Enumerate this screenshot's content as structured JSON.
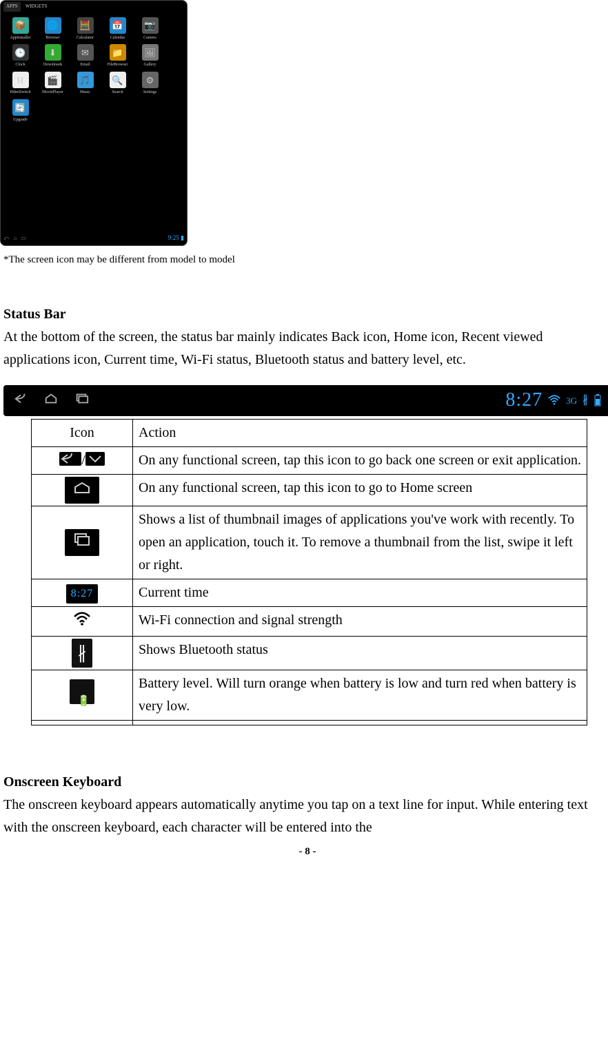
{
  "tablet": {
    "tabs": [
      "APPS",
      "WIDGETS"
    ],
    "apps": [
      {
        "label": "AppInstaller",
        "color": "#3a9",
        "glyph": "📦"
      },
      {
        "label": "Browser",
        "color": "#28c",
        "glyph": "🌐"
      },
      {
        "label": "Calculator",
        "color": "#444",
        "glyph": "🧮"
      },
      {
        "label": "Calendar",
        "color": "#28c",
        "glyph": "📅"
      },
      {
        "label": "Camera",
        "color": "#555",
        "glyph": "📷"
      },
      {
        "label": "Clock",
        "color": "#333",
        "glyph": "🕒"
      },
      {
        "label": "Downloads",
        "color": "#3a3",
        "glyph": "⬇"
      },
      {
        "label": "Email",
        "color": "#555",
        "glyph": "✉"
      },
      {
        "label": "FileBrowser",
        "color": "#c80",
        "glyph": "📁"
      },
      {
        "label": "Gallery",
        "color": "#777",
        "glyph": "🖼"
      },
      {
        "label": "HdmiSwitch",
        "color": "#eee",
        "glyph": "H"
      },
      {
        "label": "MoviePlayer",
        "color": "#eee",
        "glyph": "🎬"
      },
      {
        "label": "Music",
        "color": "#39d",
        "glyph": "🎵"
      },
      {
        "label": "Search",
        "color": "#eee",
        "glyph": "🔍"
      },
      {
        "label": "Settings",
        "color": "#666",
        "glyph": "⚙"
      },
      {
        "label": "Upgrade",
        "color": "#28c",
        "glyph": "🔄"
      }
    ],
    "nav_time": "9:25",
    "nav_sig": "▮"
  },
  "caption": "*The screen icon may be different from model to model",
  "status_section": {
    "heading": "Status Bar",
    "body": "At the bottom of the screen, the status bar mainly indicates Back icon, Home icon, Recent viewed applications icon, Current time, Wi-Fi status, Bluetooth status and battery level, etc."
  },
  "status_bar_demo": {
    "time": "8:27",
    "sig": "3G"
  },
  "table": {
    "head": [
      "Icon",
      "Action"
    ],
    "rows": [
      {
        "icon": "back",
        "action": "On any functional screen, tap this icon to go back one screen or exit application."
      },
      {
        "icon": "home",
        "action": "On any functional screen, tap this icon to go to Home screen"
      },
      {
        "icon": "recent",
        "action": "Shows a list of thumbnail images of applications you've work with recently. To open an application, touch it. To remove a thumbnail from the list, swipe it left or right."
      },
      {
        "icon": "time",
        "action": "Current time",
        "time_label": "8:27"
      },
      {
        "icon": "wifi",
        "action": "Wi-Fi connection and signal strength"
      },
      {
        "icon": "bluetooth",
        "action": "Shows Bluetooth status"
      },
      {
        "icon": "battery",
        "action": "Battery level. Will turn orange when battery is low and turn red when battery is very low."
      },
      {
        "icon": "",
        "action": ""
      }
    ]
  },
  "keyboard_section": {
    "heading": "Onscreen Keyboard",
    "body": "The onscreen keyboard appears automatically anytime you tap on a text line for input. While entering text with the onscreen keyboard, each character will be entered into the"
  },
  "page_number": "- 8 -"
}
